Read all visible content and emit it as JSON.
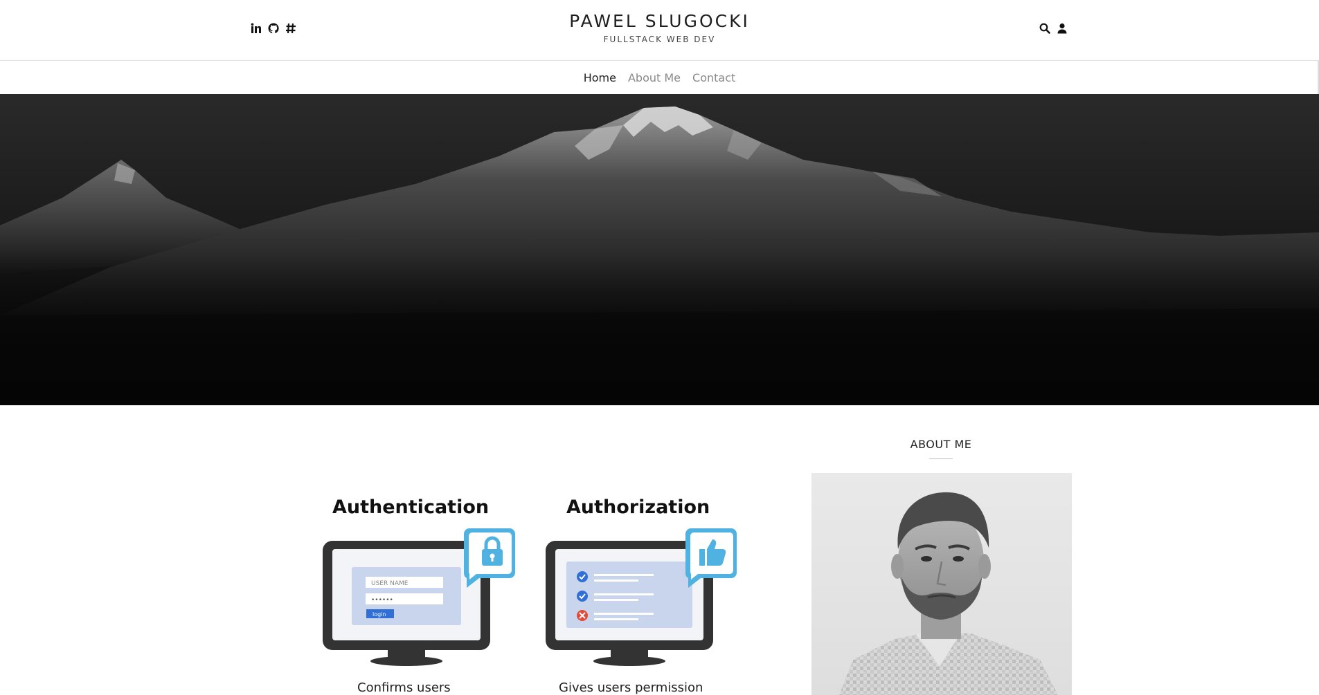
{
  "header": {
    "title": "PAWEL SLUGOCKI",
    "subtitle": "FULLSTACK WEB DEV",
    "social_icons": [
      "linkedin-icon",
      "github-icon",
      "hashnode-icon"
    ],
    "tool_icons": [
      "search-icon",
      "user-icon"
    ]
  },
  "nav": {
    "items": [
      {
        "label": "Home",
        "active": true
      },
      {
        "label": "About Me",
        "active": false
      },
      {
        "label": "Contact",
        "active": false
      }
    ]
  },
  "hero": {
    "alt": "mountain-landscape"
  },
  "post": {
    "auth_title": "Authentication",
    "authz_title": "Authorization",
    "auth_caption": "Confirms users",
    "authz_caption": "Gives users permission",
    "username_placeholder": "USER NAME",
    "password_mask": "••••••",
    "login_label": "login"
  },
  "sidebar": {
    "about_title": "ABOUT ME"
  },
  "colors": {
    "accent_blue": "#4fb2e1",
    "monitor_dark": "#333333",
    "check_blue": "#2f6fd6",
    "cross_red": "#e24a3b"
  }
}
